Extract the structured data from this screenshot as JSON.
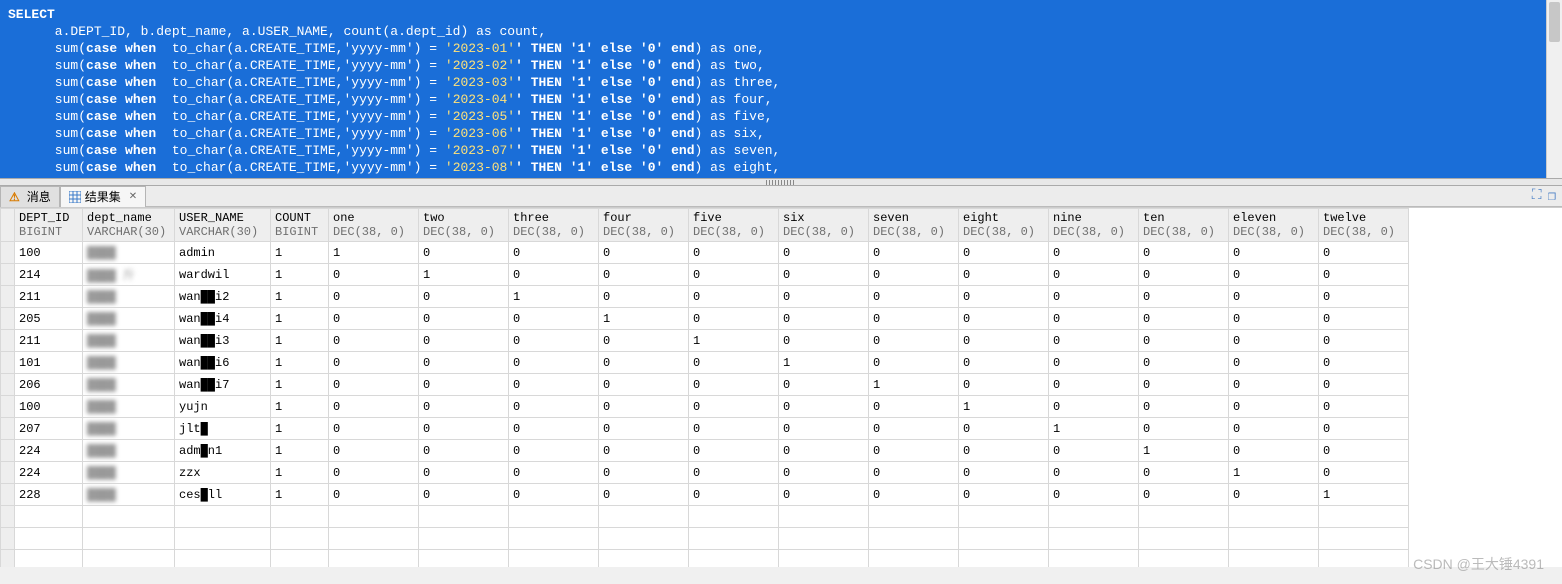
{
  "sql": {
    "line0": "SELECT",
    "line1": "      a.DEPT_ID, b.dept_name, a.USER_NAME, count(a.dept_id) as count,",
    "pre": "      sum(",
    "kw_case": "case when",
    "mid1": "  to_char(a.CREATE_TIME,'yyyy-mm') = ",
    "mid_b": "' THEN '1' else '0' end",
    "close": ") as ",
    "months": [
      {
        "m": "'2023-01'",
        "alias": "one,"
      },
      {
        "m": "'2023-02'",
        "alias": "two,"
      },
      {
        "m": "'2023-03'",
        "alias": "three,"
      },
      {
        "m": "'2023-04'",
        "alias": "four,"
      },
      {
        "m": "'2023-05'",
        "alias": "five,"
      },
      {
        "m": "'2023-06'",
        "alias": "six,"
      },
      {
        "m": "'2023-07'",
        "alias": "seven,"
      },
      {
        "m": "'2023-08'",
        "alias": "eight,"
      }
    ]
  },
  "tabs": {
    "msg": "消息",
    "result": "结果集",
    "close_x": "✕"
  },
  "columns": [
    {
      "name": "DEPT_ID",
      "type": "BIGINT",
      "cls": "c-dept"
    },
    {
      "name": "dept_name",
      "type": "VARCHAR(30)",
      "cls": "c-name"
    },
    {
      "name": "USER_NAME",
      "type": "VARCHAR(30)",
      "cls": "c-user"
    },
    {
      "name": "COUNT",
      "type": "BIGINT",
      "cls": "c-count"
    },
    {
      "name": "one",
      "type": "DEC(38, 0)",
      "cls": "c-dec"
    },
    {
      "name": "two",
      "type": "DEC(38, 0)",
      "cls": "c-dec"
    },
    {
      "name": "three",
      "type": "DEC(38, 0)",
      "cls": "c-dec"
    },
    {
      "name": "four",
      "type": "DEC(38, 0)",
      "cls": "c-dec"
    },
    {
      "name": "five",
      "type": "DEC(38, 0)",
      "cls": "c-dec"
    },
    {
      "name": "six",
      "type": "DEC(38, 0)",
      "cls": "c-dec"
    },
    {
      "name": "seven",
      "type": "DEC(38, 0)",
      "cls": "c-dec"
    },
    {
      "name": "eight",
      "type": "DEC(38, 0)",
      "cls": "c-dec"
    },
    {
      "name": "nine",
      "type": "DEC(38, 0)",
      "cls": "c-dec"
    },
    {
      "name": "ten",
      "type": "DEC(38, 0)",
      "cls": "c-dec"
    },
    {
      "name": "eleven",
      "type": "DEC(38, 0)",
      "cls": "c-dec"
    },
    {
      "name": "twelve",
      "type": "DEC(38, 0)",
      "cls": "c-dec"
    }
  ],
  "rows": [
    {
      "dept": "100",
      "dname": "████",
      "user": "admin",
      "count": "1",
      "v": [
        "1",
        "0",
        "0",
        "0",
        "0",
        "0",
        "0",
        "0",
        "0",
        "0",
        "0",
        "0"
      ]
    },
    {
      "dept": "214",
      "dname": "████ 斤",
      "user": "wardwil",
      "count": "1",
      "v": [
        "0",
        "1",
        "0",
        "0",
        "0",
        "0",
        "0",
        "0",
        "0",
        "0",
        "0",
        "0"
      ]
    },
    {
      "dept": "211",
      "dname": "████",
      "user": "wan██i2",
      "count": "1",
      "v": [
        "0",
        "0",
        "1",
        "0",
        "0",
        "0",
        "0",
        "0",
        "0",
        "0",
        "0",
        "0"
      ]
    },
    {
      "dept": "205",
      "dname": "████",
      "user": "wan██i4",
      "count": "1",
      "v": [
        "0",
        "0",
        "0",
        "1",
        "0",
        "0",
        "0",
        "0",
        "0",
        "0",
        "0",
        "0"
      ]
    },
    {
      "dept": "211",
      "dname": "████",
      "user": "wan██i3",
      "count": "1",
      "v": [
        "0",
        "0",
        "0",
        "0",
        "1",
        "0",
        "0",
        "0",
        "0",
        "0",
        "0",
        "0"
      ]
    },
    {
      "dept": "101",
      "dname": "████",
      "user": "wan██i6",
      "count": "1",
      "v": [
        "0",
        "0",
        "0",
        "0",
        "0",
        "1",
        "0",
        "0",
        "0",
        "0",
        "0",
        "0"
      ]
    },
    {
      "dept": "206",
      "dname": "████",
      "user": "wan██i7",
      "count": "1",
      "v": [
        "0",
        "0",
        "0",
        "0",
        "0",
        "0",
        "1",
        "0",
        "0",
        "0",
        "0",
        "0"
      ]
    },
    {
      "dept": "100",
      "dname": "████",
      "user": "yujn",
      "count": "1",
      "v": [
        "0",
        "0",
        "0",
        "0",
        "0",
        "0",
        "0",
        "1",
        "0",
        "0",
        "0",
        "0"
      ]
    },
    {
      "dept": "207",
      "dname": "████",
      "user": "jlt█",
      "count": "1",
      "v": [
        "0",
        "0",
        "0",
        "0",
        "0",
        "0",
        "0",
        "0",
        "1",
        "0",
        "0",
        "0"
      ]
    },
    {
      "dept": "224",
      "dname": "████",
      "user": "adm█n1",
      "count": "1",
      "v": [
        "0",
        "0",
        "0",
        "0",
        "0",
        "0",
        "0",
        "0",
        "0",
        "1",
        "0",
        "0"
      ]
    },
    {
      "dept": "224",
      "dname": "████",
      "user": "zzx",
      "count": "1",
      "v": [
        "0",
        "0",
        "0",
        "0",
        "0",
        "0",
        "0",
        "0",
        "0",
        "0",
        "1",
        "0"
      ]
    },
    {
      "dept": "228",
      "dname": "████",
      "user": "ces█ll",
      "count": "1",
      "v": [
        "0",
        "0",
        "0",
        "0",
        "0",
        "0",
        "0",
        "0",
        "0",
        "0",
        "0",
        "1"
      ]
    }
  ],
  "watermark": "CSDN @王大锤4391"
}
